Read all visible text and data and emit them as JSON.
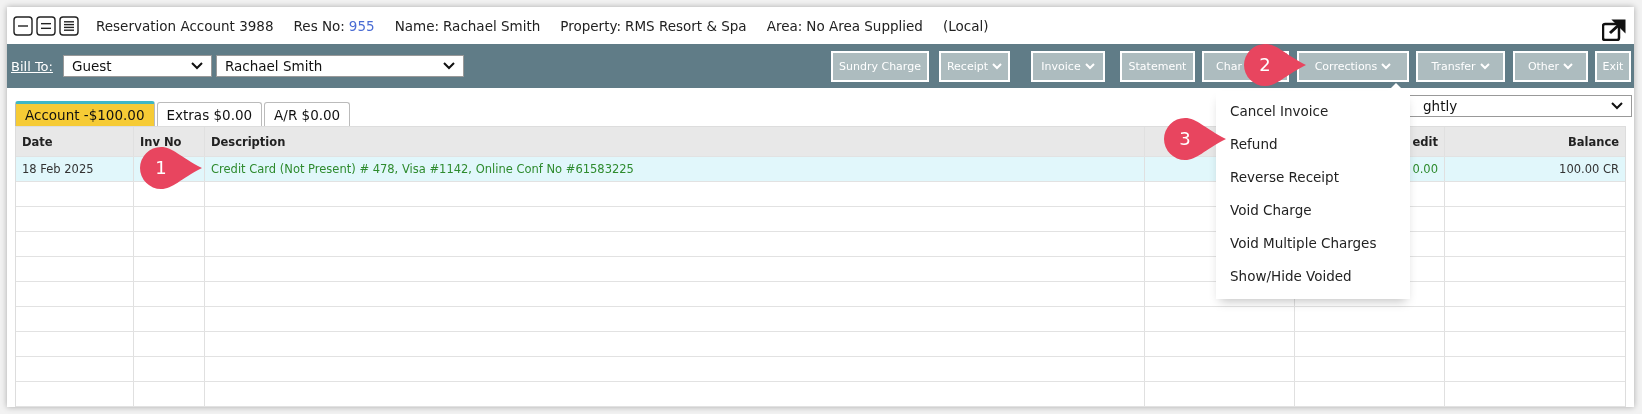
{
  "header": {
    "title": "Reservation Account 3988",
    "fields": [
      {
        "label": "Res No:",
        "value": "955",
        "kind": "link"
      },
      {
        "label": "Name:",
        "value": "Rachael Smith",
        "kind": "plain"
      },
      {
        "label": "Property:",
        "value": "RMS Resort & Spa",
        "kind": "plain"
      },
      {
        "label": "Area:",
        "value": "No Area Supplied",
        "kind": "plain"
      }
    ],
    "note": "(Local)"
  },
  "toolbar": {
    "bill_to_label": "Bill To:",
    "bill_to_type": "Guest",
    "bill_to_name": "Rachael Smith",
    "buttons": [
      {
        "label": "Sundry Charge",
        "dropdown": false
      },
      {
        "label": "Receipt",
        "dropdown": true
      },
      {
        "label": "Invoice",
        "dropdown": true
      },
      {
        "label": "Statement",
        "dropdown": false
      },
      {
        "label": "Char",
        "dropdown": false
      },
      {
        "label": "Corrections",
        "dropdown": true
      },
      {
        "label": "Transfer",
        "dropdown": true
      },
      {
        "label": "Other",
        "dropdown": true
      },
      {
        "label": "Exit",
        "dropdown": false
      }
    ]
  },
  "tabs": [
    {
      "label": "Account -$100.00",
      "selected": true
    },
    {
      "label": "Extras $0.00",
      "selected": false
    },
    {
      "label": "A/R $0.00",
      "selected": false
    }
  ],
  "view_select": {
    "value": "ghtly"
  },
  "table": {
    "columns": [
      {
        "label": "Date"
      },
      {
        "label": "Inv No"
      },
      {
        "label": "Description"
      },
      {},
      {
        "label": "edit"
      },
      {
        "label": "Balance"
      }
    ],
    "rows": [
      {
        "kind": "payment",
        "selected": true,
        "cells": [
          {
            "text": "18 Feb 2025"
          },
          {},
          {
            "text": "Credit Card (Not Present) # 478, Visa #1142, Online Conf No #61583225"
          },
          {},
          {
            "text": "0.00"
          },
          {
            "text": "100.00 CR"
          }
        ]
      }
    ]
  },
  "menu": {
    "items": [
      {
        "label": "Cancel Invoice"
      },
      {
        "label": "Refund"
      },
      {
        "label": "Reverse Receipt"
      },
      {
        "label": "Void Charge"
      },
      {
        "label": "Void Multiple Charges"
      },
      {
        "label": "Show/Hide Voided"
      }
    ]
  },
  "callouts": [
    {
      "number": "1"
    },
    {
      "number": "2"
    },
    {
      "number": "3"
    }
  ]
}
